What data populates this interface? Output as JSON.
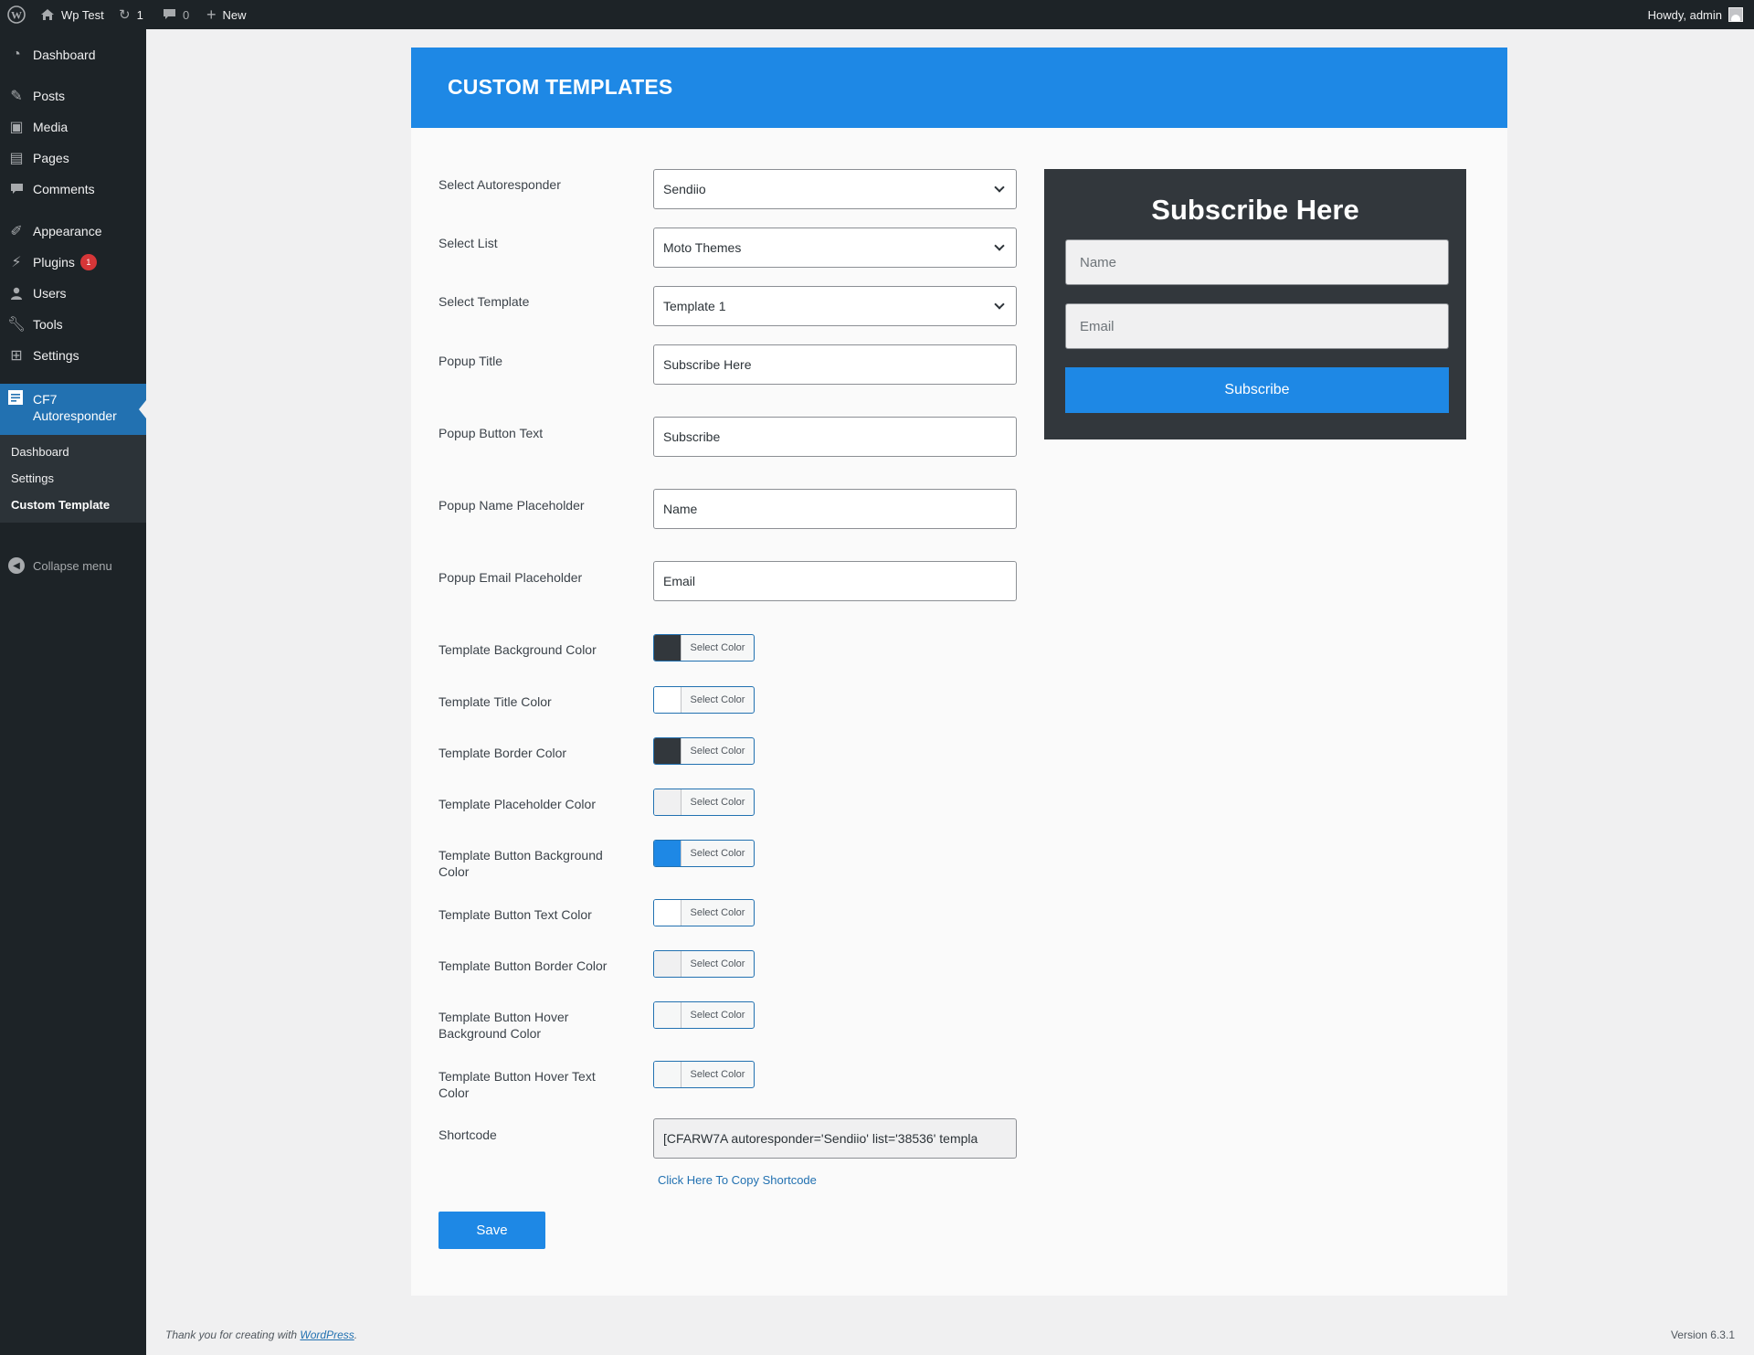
{
  "adminbar": {
    "site_name": "Wp Test",
    "updates_count": "1",
    "comments_count": "0",
    "new_label": "New",
    "howdy": "Howdy, admin"
  },
  "sidebar": {
    "dashboard": "Dashboard",
    "posts": "Posts",
    "media": "Media",
    "pages": "Pages",
    "comments": "Comments",
    "appearance": "Appearance",
    "plugins": "Plugins",
    "plugins_badge": "1",
    "users": "Users",
    "tools": "Tools",
    "settings": "Settings",
    "current": "CF7 Autoresponder",
    "sub_dashboard": "Dashboard",
    "sub_settings": "Settings",
    "sub_custom": "Custom Template",
    "collapse": "Collapse menu"
  },
  "panel": {
    "title": "CUSTOM TEMPLATES"
  },
  "form": {
    "autoresponder_label": "Select Autoresponder",
    "autoresponder_value": "Sendiio",
    "list_label": "Select List",
    "list_value": "Moto Themes",
    "template_label": "Select Template",
    "template_value": "Template 1",
    "popup_title_label": "Popup Title",
    "popup_title_value": "Subscribe Here",
    "button_text_label": "Popup Button Text",
    "button_text_value": "Subscribe",
    "name_ph_label": "Popup Name Placeholder",
    "name_ph_value": "Name",
    "email_ph_label": "Popup Email Placeholder",
    "email_ph_value": "Email",
    "select_color": "Select Color",
    "colors": {
      "bg_label": "Template Background Color",
      "bg": "#32373c",
      "title_label": "Template Title Color",
      "title": "#ffffff",
      "border_label": "Template Border Color",
      "border": "#32373c",
      "placeholder_label": "Template Placeholder Color",
      "placeholder": "#f0f0f1",
      "btn_bg_label": "Template Button Background Color",
      "btn_bg": "#1e88e5",
      "btn_text_label": "Template Button Text Color",
      "btn_text": "#ffffff",
      "btn_border_label": "Template Button Border Color",
      "btn_border": "#f0f0f1",
      "btn_hover_bg_label": "Template Button Hover Background Color",
      "btn_hover_bg": "#f6f7f7",
      "btn_hover_text_label": "Template Button Hover Text Color",
      "btn_hover_text": "#f6f7f7"
    },
    "shortcode_label": "Shortcode",
    "shortcode_value": "[CFARW7A  autoresponder='Sendiio' list='38536' templa",
    "copy_link": "Click Here To Copy Shortcode",
    "save": "Save"
  },
  "preview": {
    "title": "Subscribe Here",
    "name_placeholder": "Name",
    "email_placeholder": "Email",
    "button": "Subscribe"
  },
  "footer": {
    "thanks_prefix": "Thank you for creating with ",
    "thanks_link": "WordPress",
    "thanks_suffix": ".",
    "version": "Version 6.3.1"
  }
}
